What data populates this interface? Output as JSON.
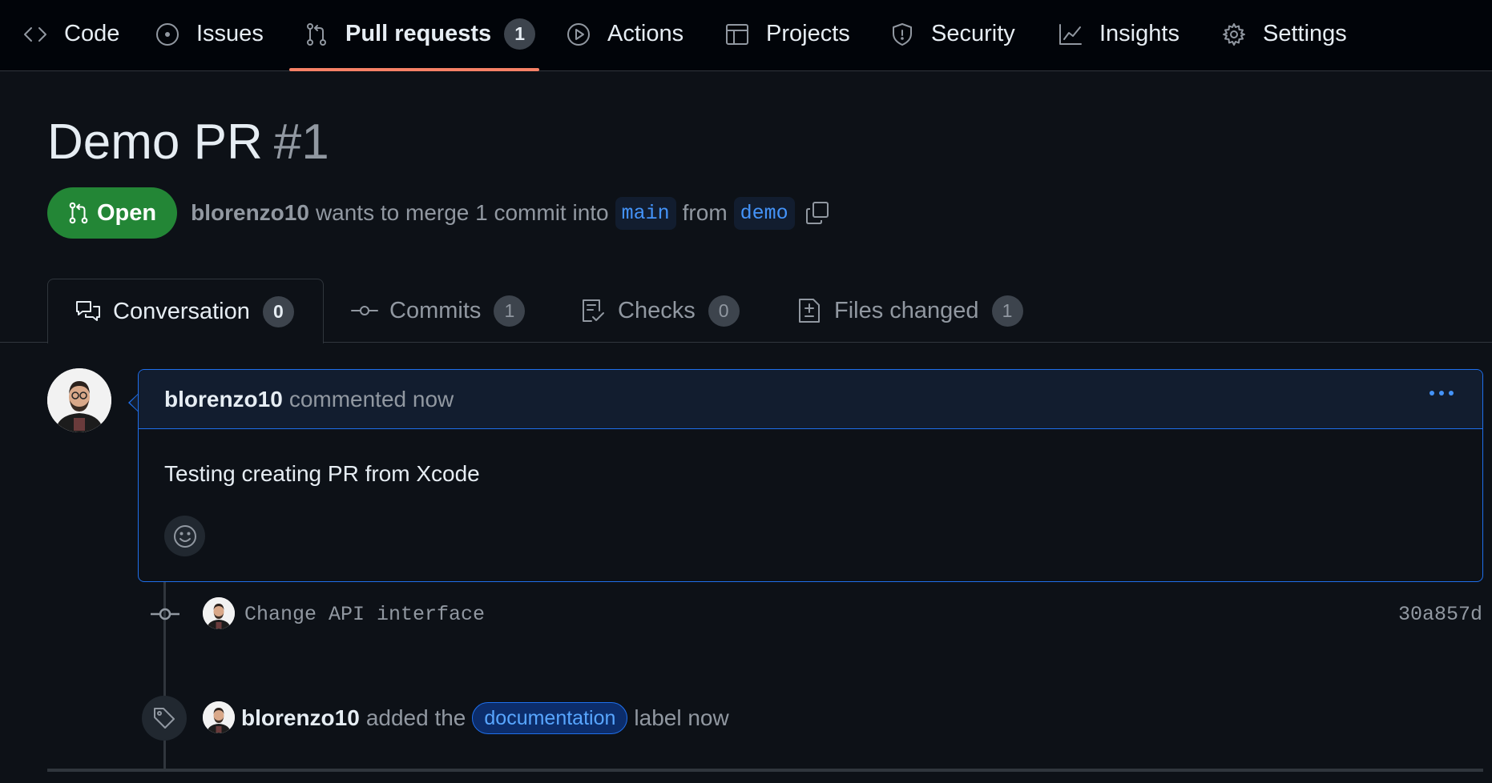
{
  "repo_nav": {
    "items": [
      {
        "label": "Code",
        "icon": "code-icon"
      },
      {
        "label": "Issues",
        "icon": "issue-opened-icon"
      },
      {
        "label": "Pull requests",
        "icon": "git-pull-request-icon",
        "counter": "1",
        "active": true
      },
      {
        "label": "Actions",
        "icon": "play-icon"
      },
      {
        "label": "Projects",
        "icon": "table-icon"
      },
      {
        "label": "Security",
        "icon": "shield-icon"
      },
      {
        "label": "Insights",
        "icon": "graph-icon"
      },
      {
        "label": "Settings",
        "icon": "gear-icon"
      }
    ],
    "active_underline_color": "#f78166"
  },
  "pr": {
    "title": "Demo PR",
    "number": "#1",
    "state": "Open",
    "state_color": "#238636",
    "author": "blorenzo10",
    "merge_text": "wants to merge 1 commit into",
    "base_branch": "main",
    "from_text": "from",
    "head_branch": "demo"
  },
  "tabs": [
    {
      "label": "Conversation",
      "counter": "0",
      "icon": "comment-discussion-icon",
      "selected": true
    },
    {
      "label": "Commits",
      "counter": "1",
      "icon": "git-commit-icon"
    },
    {
      "label": "Checks",
      "counter": "0",
      "icon": "checklist-icon"
    },
    {
      "label": "Files changed",
      "counter": "1",
      "icon": "file-diff-icon"
    }
  ],
  "comment": {
    "author": "blorenzo10",
    "meta": "commented now",
    "body": "Testing creating PR from Xcode",
    "border_color": "#1f6feb"
  },
  "timeline": {
    "commit": {
      "message": "Change API interface",
      "sha": "30a857d"
    },
    "label_event": {
      "author": "blorenzo10",
      "text_before": "added the",
      "label": "documentation",
      "text_after": "label now"
    }
  }
}
